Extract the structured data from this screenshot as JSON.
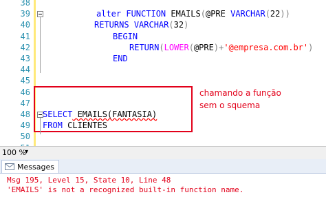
{
  "editor": {
    "lines": [
      {
        "num": "38",
        "tokens": []
      },
      {
        "num": "39",
        "tokens": [
          {
            "t": "alter",
            "c": "kw"
          },
          {
            "t": " ",
            "c": "txt"
          },
          {
            "t": "FUNCTION",
            "c": "kw"
          },
          {
            "t": " EMAILS",
            "c": "txt"
          },
          {
            "t": "(",
            "c": "sym"
          },
          {
            "t": "@PRE",
            "c": "txt"
          },
          {
            "t": " ",
            "c": "txt"
          },
          {
            "t": "VARCHAR",
            "c": "kw"
          },
          {
            "t": "(",
            "c": "sym"
          },
          {
            "t": "22",
            "c": "txt"
          },
          {
            "t": "))",
            "c": "sym"
          }
        ]
      },
      {
        "num": "40",
        "tokens": [
          {
            "t": "RETURNS",
            "c": "kw"
          },
          {
            "t": " ",
            "c": "txt"
          },
          {
            "t": "VARCHAR",
            "c": "kw"
          },
          {
            "t": "(",
            "c": "sym"
          },
          {
            "t": "32",
            "c": "txt"
          },
          {
            "t": ")",
            "c": "sym"
          }
        ]
      },
      {
        "num": "41",
        "tokens": [
          {
            "t": "BEGIN",
            "c": "kw"
          }
        ]
      },
      {
        "num": "42",
        "tokens": [
          {
            "t": "RETURN",
            "c": "kw"
          },
          {
            "t": "(",
            "c": "sym"
          },
          {
            "t": "LOWER",
            "c": "fn"
          },
          {
            "t": "(",
            "c": "sym"
          },
          {
            "t": "@PRE",
            "c": "txt"
          },
          {
            "t": ")+",
            "c": "sym"
          },
          {
            "t": "'@empresa.com.br'",
            "c": "str"
          },
          {
            "t": ")",
            "c": "sym"
          }
        ]
      },
      {
        "num": "43",
        "tokens": [
          {
            "t": "END",
            "c": "kw"
          }
        ]
      },
      {
        "num": "44",
        "tokens": []
      },
      {
        "num": "45",
        "tokens": []
      },
      {
        "num": "46",
        "tokens": []
      },
      {
        "num": "47",
        "tokens": []
      },
      {
        "num": "48",
        "tokens": [
          {
            "t": "SELECT",
            "c": "kw"
          },
          {
            "t": " EMAILS(FANTASIA)",
            "c": "txt uline"
          }
        ]
      },
      {
        "num": "49",
        "tokens": [
          {
            "t": "FROM",
            "c": "kw"
          },
          {
            "t": " CLIENTES",
            "c": "txt"
          }
        ]
      },
      {
        "num": "50",
        "tokens": []
      },
      {
        "num": "51",
        "tokens": []
      }
    ]
  },
  "annotation": {
    "line1": "chamando a função",
    "line2": "sem o squema"
  },
  "statusbar": {
    "zoom": "100 %"
  },
  "results": {
    "tab_label": "Messages",
    "messages": [
      "Msg 195, Level 15, State 10, Line 48",
      "'EMAILS' is not a recognized built-in function name."
    ]
  }
}
